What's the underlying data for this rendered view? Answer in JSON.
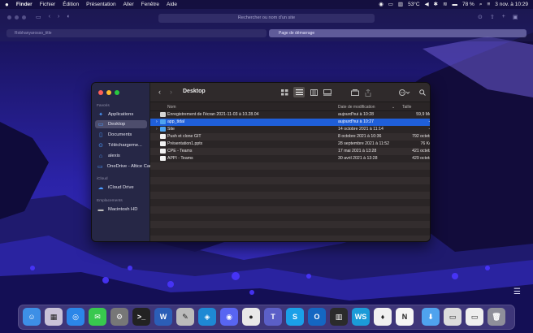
{
  "menubar": {
    "apple": "",
    "items": [
      "Finder",
      "Fichier",
      "Édition",
      "Présentation",
      "Aller",
      "Fenêtre",
      "Aide"
    ],
    "status": {
      "temperature": "53°C",
      "battery": "78 %",
      "datetime": "3 nov. à 10:29"
    }
  },
  "browser_bg": {
    "url_placeholder": "Rechercher ou nom d'un site",
    "tab_left": "Robhanyarosso_title",
    "tab_right": "Page de démarrage"
  },
  "finder": {
    "title": "Desktop",
    "sidebar": {
      "favorites_title": "Favoris",
      "favorites": [
        {
          "label": "Applications",
          "icon": "applications-icon"
        },
        {
          "label": "Desktop",
          "icon": "desktop-icon",
          "selected": true
        },
        {
          "label": "Documents",
          "icon": "document-icon"
        },
        {
          "label": "Téléchargeme...",
          "icon": "download-icon"
        },
        {
          "label": "alexis",
          "icon": "home-icon"
        },
        {
          "label": "OneDrive - Altice Campus SFR",
          "icon": "cloud-icon"
        }
      ],
      "icloud_title": "iCloud",
      "icloud": [
        {
          "label": "iCloud Drive",
          "icon": "cloud-icon"
        }
      ],
      "locations_title": "Emplacements",
      "locations": [
        {
          "label": "Macintosh HD",
          "icon": "disk-icon"
        }
      ]
    },
    "columns": {
      "name": "Nom",
      "date": "Date de modification",
      "size": "Taille"
    },
    "rows": [
      {
        "name": "Enregistrement de l'écran 2021-11-03 à 10.28.04",
        "date": "aujourd'hui à 10:28",
        "size": "59,9 Mo",
        "kind": "file-gray",
        "chevron": ""
      },
      {
        "name": "app_tidal",
        "date": "aujourd'hui à 10:27",
        "size": "--",
        "kind": "folder-blue",
        "chevron": "›",
        "selected": true
      },
      {
        "name": "Site",
        "date": "14 octobre 2021 à 11:14",
        "size": "--",
        "kind": "folder-blue",
        "chevron": "›"
      },
      {
        "name": "Push et clone GIT",
        "date": "8 octobre 2021 à 10:36",
        "size": "792 octets",
        "kind": "file-white",
        "chevron": ""
      },
      {
        "name": "Présentation1.pptx",
        "date": "28 septembre 2021 à 11:52",
        "size": "76 Ko",
        "kind": "file-white",
        "chevron": ""
      },
      {
        "name": "CPE - Teams",
        "date": "17 mai 2021 à 13:28",
        "size": "421 octets",
        "kind": "file-white",
        "chevron": ""
      },
      {
        "name": "APPI - Teams",
        "date": "30 avril 2021 à 13:28",
        "size": "429 octets",
        "kind": "file-white",
        "chevron": ""
      }
    ]
  },
  "dock": {
    "apps": [
      {
        "name": "finder",
        "glyph": "☺",
        "color": "#3d8fe6"
      },
      {
        "name": "launchpad",
        "glyph": "▦",
        "color": "#c9c2d8"
      },
      {
        "name": "safari",
        "glyph": "◎",
        "color": "#2b86e8"
      },
      {
        "name": "messages",
        "glyph": "✉",
        "color": "#38c84e"
      },
      {
        "name": "system-preferences",
        "glyph": "⚙",
        "color": "#777"
      },
      {
        "name": "terminal",
        "glyph": ">_",
        "color": "#222"
      },
      {
        "name": "word",
        "glyph": "W",
        "color": "#2b5eb7"
      },
      {
        "name": "script-editor",
        "glyph": "✎",
        "color": "#bbb"
      },
      {
        "name": "vscode",
        "glyph": "◈",
        "color": "#1e89d4"
      },
      {
        "name": "discord",
        "glyph": "◉",
        "color": "#5865f2"
      },
      {
        "name": "chrome",
        "glyph": "●",
        "color": "#e8e8e8"
      },
      {
        "name": "teams",
        "glyph": "T",
        "color": "#5b5fc7"
      },
      {
        "name": "skype",
        "glyph": "S",
        "color": "#1aa0e8"
      },
      {
        "name": "outlook",
        "glyph": "O",
        "color": "#1467c2"
      },
      {
        "name": "activity-monitor",
        "glyph": "▥",
        "color": "#2b2b2b"
      },
      {
        "name": "webstorm",
        "glyph": "WS",
        "color": "#1b9bd8"
      },
      {
        "name": "tidal",
        "glyph": "♦",
        "color": "#f0f0f0"
      },
      {
        "name": "notion",
        "glyph": "N",
        "color": "#f5f5f5"
      },
      {
        "name": "downloads-folder",
        "glyph": "⬇",
        "color": "#4fa3ee"
      },
      {
        "name": "screenshot-1",
        "glyph": "▭",
        "color": "#dcdcdc"
      },
      {
        "name": "screenshot-2",
        "glyph": "▭",
        "color": "#efefef"
      },
      {
        "name": "trash",
        "glyph": "🗑",
        "color": "#8f8f9a"
      }
    ]
  }
}
